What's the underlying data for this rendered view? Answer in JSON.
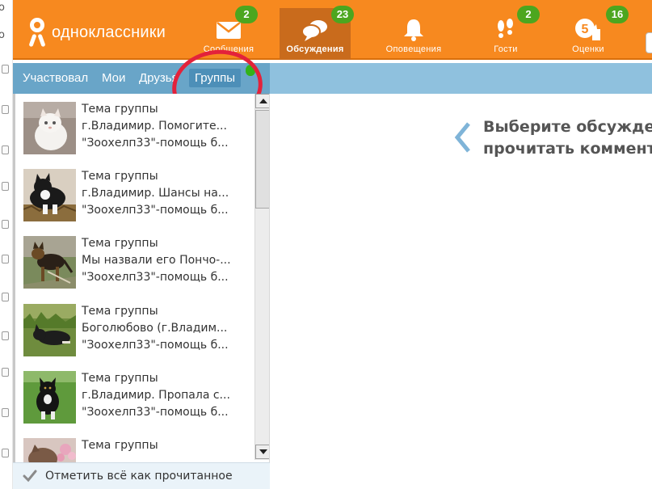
{
  "app": {
    "logo_text": "одноклассники"
  },
  "nav": [
    {
      "id": "messages",
      "label": "Сообщения",
      "badge": "2",
      "icon": "envelope-icon"
    },
    {
      "id": "discussions",
      "label": "Обсуждения",
      "badge": "23",
      "icon": "discussions-icon",
      "active": true
    },
    {
      "id": "notifications",
      "label": "Оповещения",
      "badge": "",
      "icon": "bell-icon"
    },
    {
      "id": "guests",
      "label": "Гости",
      "badge": "2",
      "icon": "footprints-icon"
    },
    {
      "id": "ratings",
      "label": "Оценки",
      "badge": "16",
      "icon": "rating-5-icon"
    }
  ],
  "subtabs": {
    "items": [
      "Участвовал",
      "Мои",
      "Друзья",
      "Группы"
    ],
    "selected": "Группы"
  },
  "discussions": [
    {
      "title": "Тема группы",
      "line2": "г.Владимир. Помогите...",
      "line3": "\"Зоохелп33\"-помощь б...",
      "thumb": "white-kitten"
    },
    {
      "title": "Тема группы",
      "line2": "г.Владимир. Шансы на...",
      "line3": "\"Зоохелп33\"-помощь б...",
      "thumb": "black-white-cat"
    },
    {
      "title": "Тема группы",
      "line2": "Мы назвали его Пончо-...",
      "line3": "\"Зоохелп33\"-помощь б...",
      "thumb": "shepherd-dog"
    },
    {
      "title": "Тема группы",
      "line2": "Боголюбово (г.Владим...",
      "line3": "\"Зоохелп33\"-помощь б...",
      "thumb": "dog-in-grass"
    },
    {
      "title": "Тема группы",
      "line2": "г.Владимир. Пропала с...",
      "line3": "\"Зоохелп33\"-помощь б...",
      "thumb": "puppy-on-grass"
    },
    {
      "title": "Тема группы",
      "line2": "",
      "line3": "",
      "thumb": "cat-pink-flowers"
    }
  ],
  "footer": {
    "mark_all_read": "Отметить всё как прочитанное"
  },
  "main": {
    "prompt_line1": "Выберите обсужде",
    "prompt_line2": "прочитать коммент"
  },
  "colors": {
    "topbar": "#f7891f",
    "active_nav": "#c96b1c",
    "badge": "#4ca61f",
    "subtabs": "#69a5c8",
    "annotation": "#e3223b"
  }
}
